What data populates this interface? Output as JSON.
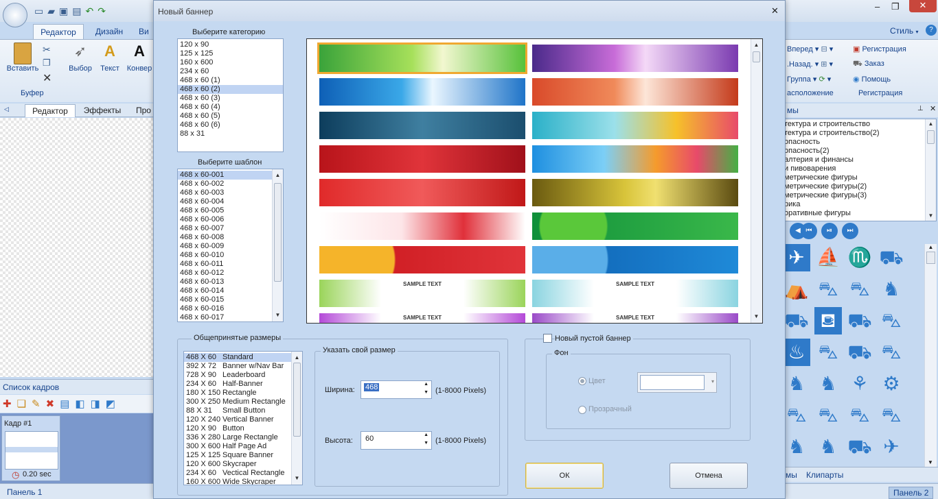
{
  "ribbon": {
    "tabs": [
      "Редактор",
      "Дизайн",
      "Ви"
    ],
    "right_label": "Стиль",
    "tools": {
      "paste": "Вставить",
      "select": "Выбор",
      "text": "Текст",
      "convert": "Конвер"
    },
    "group_buffer": "Буфер",
    "arrange": {
      "forward": "Вперед",
      "back": ".Назад.",
      "group": "Группа",
      "title": "асположение"
    },
    "registration": {
      "register": "Регистрация",
      "order": "Заказ",
      "help": "Помощь",
      "title": "Регистрация"
    }
  },
  "left": {
    "tabs": [
      "Редактор",
      "Эффекты",
      "Про"
    ],
    "frames_title": "Список кадров",
    "frame_label": "Кадр #1",
    "frame_time": "0.20 sec",
    "status": "Панель 1"
  },
  "right": {
    "panel_title": "мы",
    "categories": [
      "тектура и строительство",
      "тектура и строительство(2)",
      "опасность",
      "опасность(2)",
      "алтерия и финансы",
      "и пивоварения",
      "метрические фигуры",
      "метрические фигуры(2)",
      "метрические фигуры(3)",
      "рика",
      "оративные фигуры"
    ],
    "tabs": [
      "мы",
      "Клипарты"
    ],
    "status": "Панель 2"
  },
  "dialog": {
    "title": "Новый баннер",
    "category_label": "Выберите категорию",
    "categories": [
      "120 x 90",
      "125 x 125",
      "160 x 600",
      "234 x 60",
      "468 x 60 (1)",
      "468 x 60 (2)",
      "468 x 60 (3)",
      "468 x 60 (4)",
      "468 x 60 (5)",
      "468 x 60 (6)",
      "88 x 31"
    ],
    "category_selected": 5,
    "template_label": "Выберите шаблон",
    "templates": [
      "468 x 60-001",
      "468 x 60-002",
      "468 x 60-003",
      "468 x 60-004",
      "468 x 60-005",
      "468 x 60-006",
      "468 x 60-007",
      "468 x 60-008",
      "468 x 60-009",
      "468 x 60-010",
      "468 x 60-011",
      "468 x 60-012",
      "468 x 60-013",
      "468 x 60-014",
      "468 x 60-015",
      "468 x 60-016",
      "468 x 60-017"
    ],
    "template_selected": 0,
    "sample_text": "SAMPLE TEXT",
    "common_sizes_label": "Общепринятые размеры",
    "sizes": [
      {
        "size": "468 X 60",
        "name": "Standard"
      },
      {
        "size": "392 X 72",
        "name": "Banner w/Nav Bar"
      },
      {
        "size": "728 X 90",
        "name": "Leaderboard"
      },
      {
        "size": "234 X 60",
        "name": "Half-Banner"
      },
      {
        "size": "180 X 150",
        "name": "Rectangle"
      },
      {
        "size": "300 X 250",
        "name": "Medium Rectangle"
      },
      {
        "size": "88 X 31",
        "name": "Small Button"
      },
      {
        "size": "120 X 240",
        "name": "Vertical Banner"
      },
      {
        "size": "120 X 90",
        "name": "Button"
      },
      {
        "size": "336 X 280",
        "name": "Large Rectangle"
      },
      {
        "size": "300 X 600",
        "name": "Half Page Ad"
      },
      {
        "size": "125 X 125",
        "name": "Square Banner"
      },
      {
        "size": "120 X 600",
        "name": "Skycraper"
      },
      {
        "size": "234 X 60",
        "name": "Vectical Rectangle"
      },
      {
        "size": "160 X 600",
        "name": "Wide Skycraper"
      }
    ],
    "size_selected": 0,
    "custom_label": "Указать свой размер",
    "width_label": "Ширина:",
    "width_value": "468",
    "height_label": "Высота:",
    "height_value": "60",
    "range_hint": "(1-8000 Pixels)",
    "new_empty_label": "Новый пустой баннер",
    "bg_label": "Фон",
    "color_label": "Цвет",
    "transparent_label": "Прозрачный",
    "ok": "ОК",
    "cancel": "Отмена"
  },
  "colors": {
    "accent": "#c5d9f1",
    "selection": "#c0d4f3",
    "icon_blue": "#2f7ac9"
  }
}
